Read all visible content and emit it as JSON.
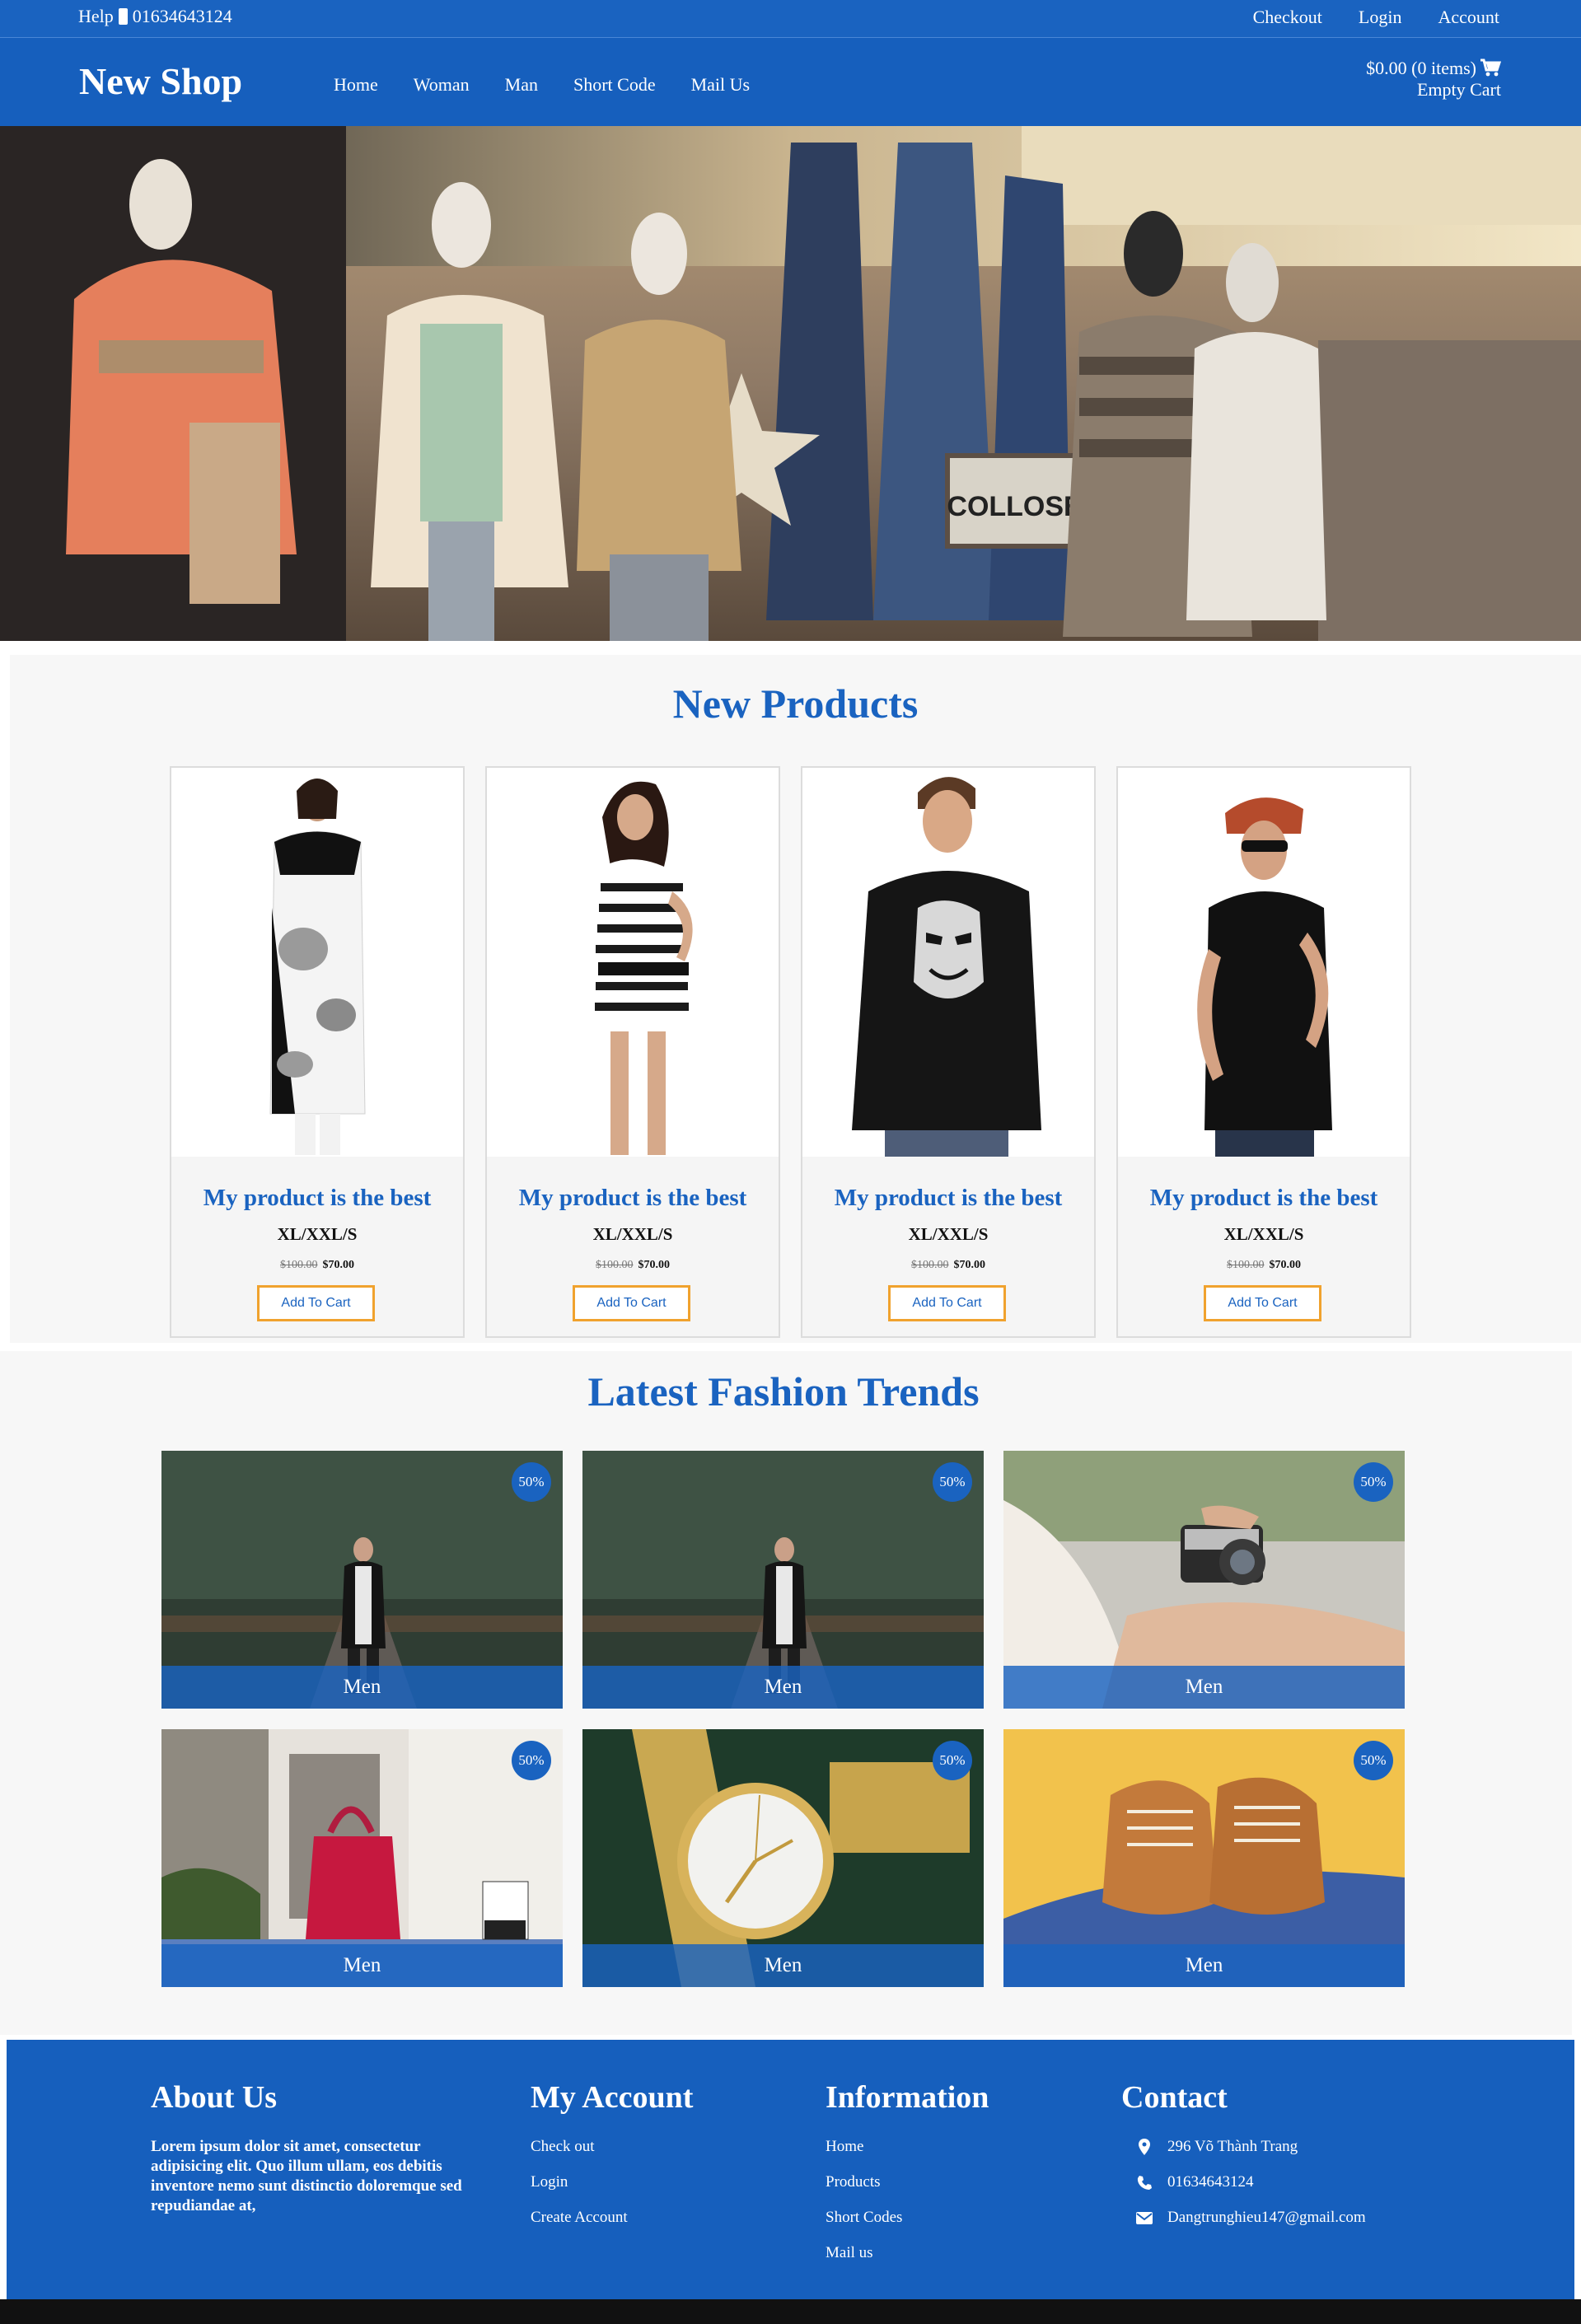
{
  "topbar": {
    "help": "Help",
    "phone": "01634643124",
    "links": [
      "Checkout",
      "Login",
      "Account"
    ]
  },
  "header": {
    "logo": "New Shop",
    "nav": [
      "Home",
      "Woman",
      "Man",
      "Short Code",
      "Mail Us"
    ],
    "cart_total": "$0.00 (0 items)",
    "cart_status": "Empty Cart"
  },
  "new_products": {
    "title": "New Products",
    "items": [
      {
        "name": "My product is the best",
        "sizes": "XL/XXL/S",
        "old_price": "$100.00",
        "price": "$70.00",
        "button": "Add To Cart"
      },
      {
        "name": "My product is the best",
        "sizes": "XL/XXL/S",
        "old_price": "$100.00",
        "price": "$70.00",
        "button": "Add To Cart"
      },
      {
        "name": "My product is the best",
        "sizes": "XL/XXL/S",
        "old_price": "$100.00",
        "price": "$70.00",
        "button": "Add To Cart"
      },
      {
        "name": "My product is the best",
        "sizes": "XL/XXL/S",
        "old_price": "$100.00",
        "price": "$70.00",
        "button": "Add To Cart"
      }
    ]
  },
  "trends": {
    "title": "Latest Fashion Trends",
    "items": [
      {
        "badge": "50%",
        "caption": "Men"
      },
      {
        "badge": "50%",
        "caption": "Men"
      },
      {
        "badge": "50%",
        "caption": "Men"
      },
      {
        "badge": "50%",
        "caption": "Men"
      },
      {
        "badge": "50%",
        "caption": "Men"
      },
      {
        "badge": "50%",
        "caption": "Men"
      }
    ]
  },
  "footer": {
    "about": {
      "title": "About Us",
      "text": "Lorem ipsum dolor sit amet, consectetur adipisicing elit. Quo illum ullam, eos debitis inventore nemo sunt distinctio doloremque sed repudiandae at,"
    },
    "account": {
      "title": "My Account",
      "links": [
        "Check out",
        "Login",
        "Create Account"
      ]
    },
    "information": {
      "title": "Information",
      "links": [
        "Home",
        "Products",
        "Short Codes",
        "Mail us"
      ]
    },
    "contact": {
      "title": "Contact",
      "address": "296 Võ Thành Trang",
      "phone": "01634643124",
      "email": "Dangtrunghieu147@gmail.com"
    }
  },
  "colors": {
    "brand": "#1a63c0",
    "button_border": "#f0a22e",
    "footer": "#165fbd"
  }
}
